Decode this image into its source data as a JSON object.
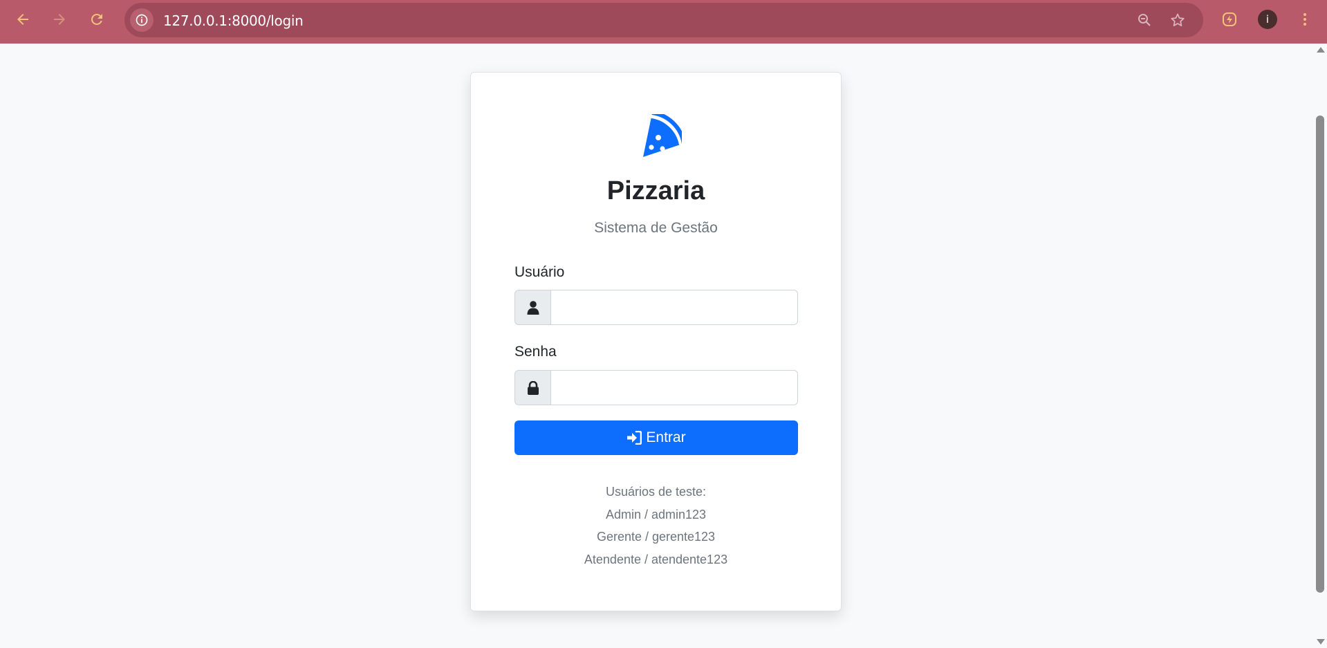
{
  "browser": {
    "url": "127.0.0.1:8000/login",
    "profile_initial": "i",
    "theme_color": "#b95a6a",
    "icon_color": "#f3c27a"
  },
  "login": {
    "logo_icon": "pizza-slice-icon",
    "title": "Pizzaria",
    "subtitle": "Sistema de Gestão",
    "user_label": "Usuário",
    "user_value": "",
    "password_label": "Senha",
    "password_value": "",
    "submit_label": "Entrar",
    "accent_color": "#0d6efd",
    "test_users_heading": "Usuários de teste:",
    "test_users": [
      "Admin / admin123",
      "Gerente / gerente123",
      "Atendente / atendente123"
    ]
  }
}
